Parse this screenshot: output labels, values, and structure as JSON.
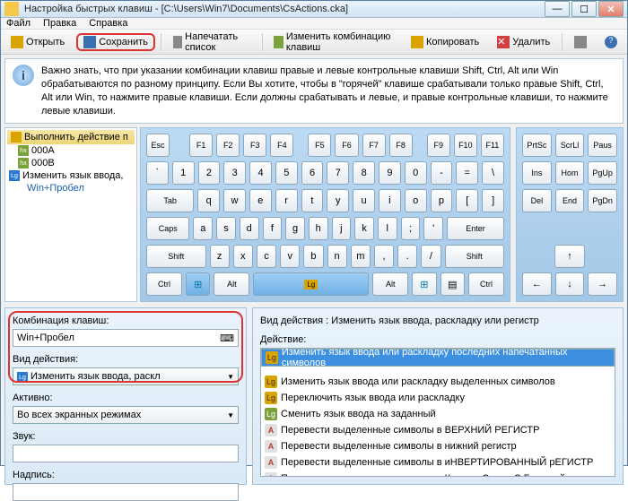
{
  "window": {
    "title": "Настройка быстрых клавиш - [C:\\Users\\Win7\\Documents\\CsActions.cka]"
  },
  "menu": {
    "file": "Файл",
    "edit": "Правка",
    "help": "Справка"
  },
  "toolbar": {
    "open": "Открыть",
    "save": "Сохранить",
    "print": "Напечатать список",
    "change": "Изменить комбинацию клавиш",
    "copy": "Копировать",
    "delete": "Удалить"
  },
  "info": "Важно знать, что при указании комбинации клавиш правые и левые контрольные клавиши Shift, Ctrl, Alt или Win обрабатываются по разному принципу. Если Вы хотите, чтобы в \"горячей\" клавише срабатывали только правые Shift, Ctrl, Alt или Win, то нажмите правые клавиши. Если должны срабатывать и левые, и правые контрольные клавиши, то нажмите левые клавиши.",
  "tree": {
    "header": "Выполнить действие п",
    "items": [
      "000A",
      "000B"
    ],
    "lang": "Изменить язык ввода,",
    "combo": "Win+Пробел"
  },
  "keys": {
    "esc": "Esc",
    "f1": "F1",
    "f2": "F2",
    "f3": "F3",
    "f4": "F4",
    "f5": "F5",
    "f6": "F6",
    "f7": "F7",
    "f8": "F8",
    "f9": "F9",
    "f10": "F10",
    "f11": "F11",
    "tab": "Tab",
    "caps": "Caps",
    "shift": "Shift",
    "ctrl": "Ctrl",
    "alt": "Alt",
    "enter": "Enter",
    "ins": "Ins",
    "home": "Hom",
    "pgup": "PgUp",
    "del": "Del",
    "end": "End",
    "pgdn": "PgDn",
    "prtsc": "PrtSc",
    "scrl": "ScrLl",
    "paus": "Paus",
    "up": "↑",
    "left": "←",
    "down": "↓",
    "right": "→",
    "r1": [
      "`",
      "1",
      "2",
      "3",
      "4",
      "5",
      "6",
      "7",
      "8",
      "9",
      "0",
      "-",
      "=",
      "\\"
    ],
    "r2": [
      "q",
      "w",
      "e",
      "r",
      "t",
      "y",
      "u",
      "i",
      "o",
      "p",
      "[",
      "]"
    ],
    "r3": [
      "a",
      "s",
      "d",
      "f",
      "g",
      "h",
      "j",
      "k",
      "l",
      ";",
      "'"
    ],
    "r4": [
      "z",
      "x",
      "c",
      "v",
      "b",
      "n",
      "m",
      ",",
      ".",
      "/"
    ]
  },
  "left": {
    "comboLbl": "Комбинация клавиш:",
    "comboVal": "Win+Пробел",
    "typeLbl": "Вид действия:",
    "typeVal": "Изменить язык ввода, раскл",
    "activeLbl": "Активно:",
    "activeVal": "Во всех экранных режимах",
    "soundLbl": "Звук:",
    "captionLbl": "Надпись:"
  },
  "right": {
    "header": "Вид действия : Изменить язык ввода, раскладку или регистр",
    "actionLbl": "Действие:",
    "actions": [
      {
        "i": "lg",
        "t": "Изменить язык ввода или раскладку последних напечатанных символов"
      },
      {
        "i": "lg",
        "t": "Изменить язык ввода или раскладку выделенных символов"
      },
      {
        "i": "lg",
        "t": "Переключить язык ввода или раскладку"
      },
      {
        "i": "lg2",
        "t": "Сменить язык ввода на заданный"
      },
      {
        "i": "a",
        "t": "Перевести выделенные символы в ВЕРХНИЙ РЕГИСТР"
      },
      {
        "i": "a",
        "t": "Перевести выделенные символы в нижний регистр"
      },
      {
        "i": "a",
        "t": "Перевести выделенные символы в иНВЕРТИРОВАННЫЙ рЕГИСТР"
      },
      {
        "i": "a",
        "t": "Перевести выделенные символы в Каждое Слово С Большой"
      }
    ]
  }
}
